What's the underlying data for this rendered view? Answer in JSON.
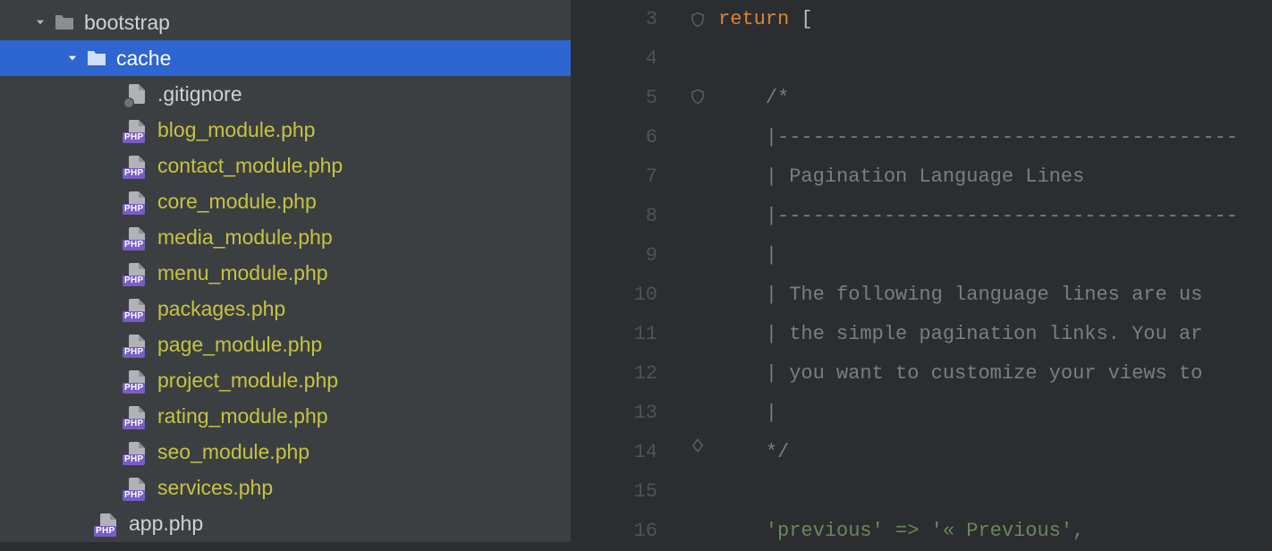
{
  "tree": {
    "root": {
      "name": "bootstrap",
      "expanded": true
    },
    "folder": {
      "name": "cache",
      "expanded": true,
      "selected": true
    },
    "files": [
      {
        "name": ".gitignore",
        "type": "gitignore",
        "vcs": "normal"
      },
      {
        "name": "blog_module.php",
        "type": "php",
        "vcs": "added"
      },
      {
        "name": "contact_module.php",
        "type": "php",
        "vcs": "added"
      },
      {
        "name": "core_module.php",
        "type": "php",
        "vcs": "added"
      },
      {
        "name": "media_module.php",
        "type": "php",
        "vcs": "added"
      },
      {
        "name": "menu_module.php",
        "type": "php",
        "vcs": "added"
      },
      {
        "name": "packages.php",
        "type": "php",
        "vcs": "added"
      },
      {
        "name": "page_module.php",
        "type": "php",
        "vcs": "added"
      },
      {
        "name": "project_module.php",
        "type": "php",
        "vcs": "added"
      },
      {
        "name": "rating_module.php",
        "type": "php",
        "vcs": "added"
      },
      {
        "name": "seo_module.php",
        "type": "php",
        "vcs": "added"
      },
      {
        "name": "services.php",
        "type": "php",
        "vcs": "added"
      }
    ],
    "siblingFile": {
      "name": "app.php",
      "type": "php",
      "vcs": "normal"
    }
  },
  "editor": {
    "startLine": 3,
    "endLine": 16,
    "gutterMarks": {
      "3": "shield",
      "5": "shield",
      "14": "diamond"
    },
    "code": {
      "l3": {
        "kw": "return",
        "rest": " ["
      },
      "l4": "",
      "l5": "    /*",
      "l6": "    |---------------------------------------",
      "l7": "    | Pagination Language Lines",
      "l8": "    |---------------------------------------",
      "l9": "    |",
      "l10": "    | The following language lines are us",
      "l11": "    | the simple pagination links. You ar",
      "l12": "    | you want to customize your views to",
      "l13": "    |",
      "l14": "    */",
      "l15": "",
      "l16": "    'previous' => '&laquo; Previous',"
    }
  },
  "iconBadges": {
    "php": "PHP"
  }
}
